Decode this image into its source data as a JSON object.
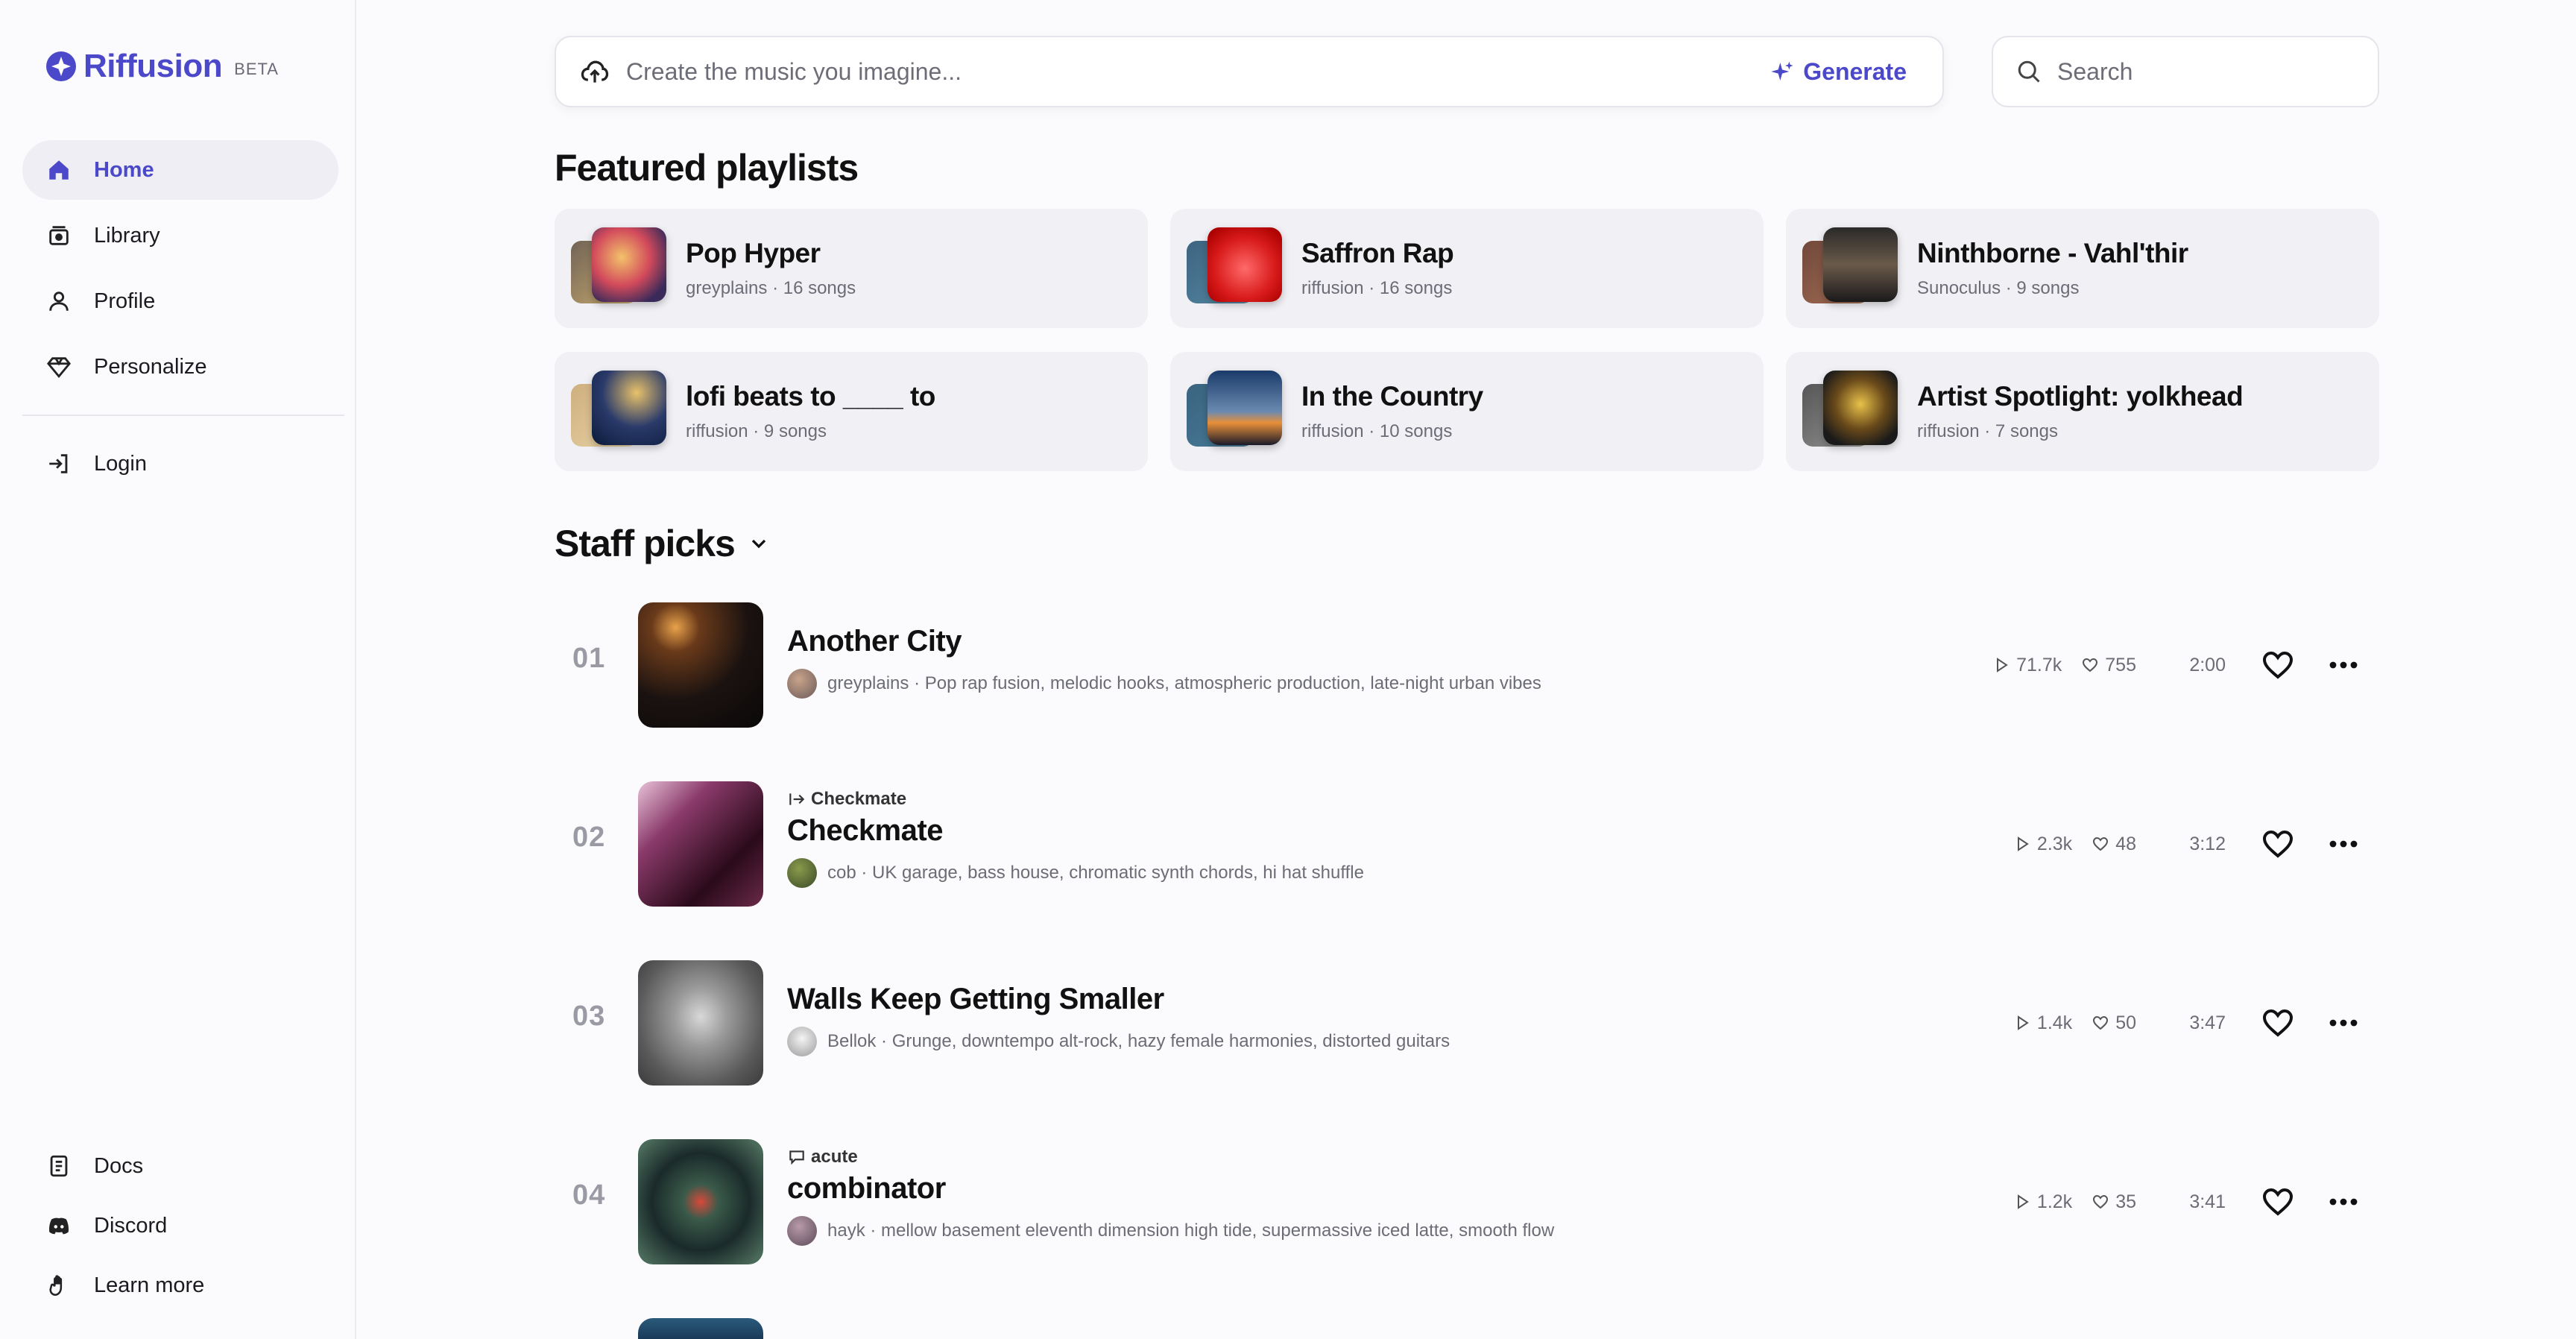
{
  "app": {
    "name": "Riffusion",
    "badge": "BETA"
  },
  "sidebar": {
    "items": [
      {
        "label": "Home",
        "icon": "home-icon",
        "active": true
      },
      {
        "label": "Library",
        "icon": "library-icon"
      },
      {
        "label": "Profile",
        "icon": "user-icon"
      },
      {
        "label": "Personalize",
        "icon": "gem-icon"
      },
      {
        "label": "Login",
        "icon": "login-icon"
      }
    ],
    "footer": [
      {
        "label": "Docs",
        "icon": "doc-icon"
      },
      {
        "label": "Discord",
        "icon": "discord-icon"
      },
      {
        "label": "Learn more",
        "icon": "hand-icon"
      }
    ]
  },
  "prompt": {
    "placeholder": "Create the music you imagine...",
    "generate_label": "Generate"
  },
  "search": {
    "placeholder": "Search"
  },
  "featured": {
    "title": "Featured playlists",
    "playlists": [
      {
        "name": "Pop Hyper",
        "meta": "greyplains · 16 songs"
      },
      {
        "name": "Saffron Rap",
        "meta": "riffusion · 16 songs"
      },
      {
        "name": "Ninthborne - Vahl'thir",
        "meta": "Sunoculus · 9 songs"
      },
      {
        "name": "lofi beats to ____ to",
        "meta": "riffusion · 9 songs"
      },
      {
        "name": "In the Country",
        "meta": "riffusion · 10 songs"
      },
      {
        "name": "Artist Spotlight: yolkhead",
        "meta": "riffusion · 7 songs"
      }
    ]
  },
  "staff": {
    "title": "Staff picks",
    "tracks": [
      {
        "num": "01",
        "badge": "",
        "title": "Another City",
        "artist": "greyplains",
        "desc": "Pop rap fusion, melodic hooks, atmospheric production, late-night urban vibes",
        "plays": "71.7k",
        "likes": "755",
        "duration": "2:00"
      },
      {
        "num": "02",
        "badge": "Checkmate",
        "title": "Checkmate",
        "artist": "cob",
        "desc": "UK garage, bass house, chromatic synth chords, hi hat shuffle",
        "plays": "2.3k",
        "likes": "48",
        "duration": "3:12"
      },
      {
        "num": "03",
        "badge": "",
        "title": "Walls Keep Getting Smaller",
        "artist": "Bellok",
        "desc": "Grunge, downtempo alt-rock, hazy female harmonies, distorted guitars",
        "plays": "1.4k",
        "likes": "50",
        "duration": "3:47"
      },
      {
        "num": "04",
        "badge": "acute",
        "title": "combinator",
        "artist": "hayk",
        "desc": "mellow basement eleventh dimension high tide, supermassive iced latte, smooth flow",
        "plays": "1.2k",
        "likes": "35",
        "duration": "3:41"
      }
    ]
  },
  "colors": {
    "accent": "#4b48c9",
    "background": "#fbfbfd",
    "card": "#f1f1f5"
  }
}
